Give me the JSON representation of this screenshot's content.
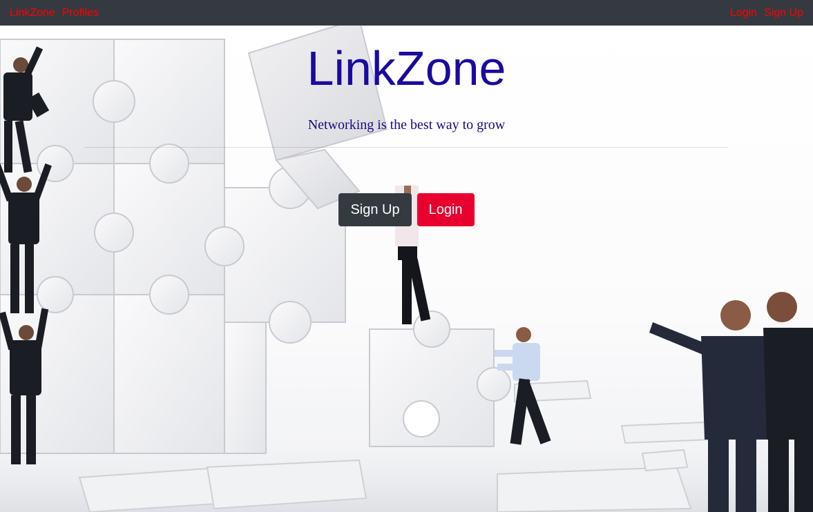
{
  "theme": {
    "navbar_bg": "#343a40",
    "nav_link_color": "#ff0000",
    "title_color": "#1a0aa0",
    "tagline_color": "#1a0a7a",
    "signup_button_bg": "#343a40",
    "login_button_bg": "#e8002e"
  },
  "navbar": {
    "brand": "LinkZone",
    "left_links": [
      "Profiles"
    ],
    "right_links": [
      "Login",
      "Sign Up"
    ]
  },
  "hero": {
    "title": "LinkZone",
    "tagline": "Networking is the best way to grow",
    "signup_button": "Sign Up",
    "login_button": "Login"
  },
  "background": {
    "image_subject": "business people assembling giant white puzzle pieces"
  }
}
